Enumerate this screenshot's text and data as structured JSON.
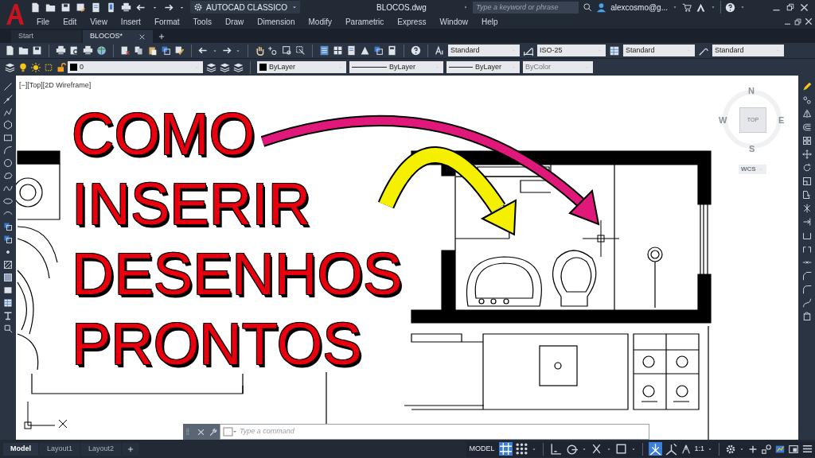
{
  "title_bar": {
    "workspace": "AUTOCAD CLASSICO",
    "file_name": "BLOCOS.dwg",
    "search": {
      "placeholder": "Type a keyword or phrase"
    },
    "user": "alexcosmo@g..."
  },
  "menu": [
    "File",
    "Edit",
    "View",
    "Insert",
    "Format",
    "Tools",
    "Draw",
    "Dimension",
    "Modify",
    "Parametric",
    "Express",
    "Window",
    "Help"
  ],
  "file_tabs": [
    {
      "label": "Start",
      "selected": false
    },
    {
      "label": "BLOCOS*",
      "selected": true
    }
  ],
  "styles_toolbar": {
    "text_style": "Standard",
    "dim_style": "ISO-25",
    "table_style": "Standard",
    "multileader_style": "Standard"
  },
  "properties_bar": {
    "layer": "0",
    "color_setting": "ByLayer",
    "linetype": "ByLayer",
    "lineweight": "ByLayer",
    "plot_style": {
      "value": "ByColor",
      "disabled": true
    }
  },
  "viewport_label": "[−][Top][2D Wireframe]",
  "headline": [
    "COMO",
    "INSERIR",
    "DESENHOS",
    "PRONTOS"
  ],
  "view_cube": {
    "north": "N",
    "west": "W",
    "east": "E",
    "south": "S",
    "face": "TOP",
    "ucs": "WCS"
  },
  "command_line": {
    "placeholder": "Type a command"
  },
  "layout_tabs": [
    {
      "label": "Model",
      "selected": true
    },
    {
      "label": "Layout1",
      "selected": false
    },
    {
      "label": "Layout2",
      "selected": false
    }
  ],
  "status_bar": {
    "space": "MODEL",
    "scale": "1:1",
    "toggles": [
      {
        "kind": "grid",
        "on": true
      },
      {
        "kind": "snap",
        "on": false
      },
      {
        "kind": "ortho",
        "on": false
      },
      {
        "kind": "polar",
        "on": false
      },
      {
        "kind": "isodraft",
        "on": false
      },
      {
        "kind": "osnap",
        "on": false
      },
      {
        "kind": "annotation",
        "on": true
      },
      {
        "kind": "autoscale",
        "on": false
      }
    ]
  }
}
